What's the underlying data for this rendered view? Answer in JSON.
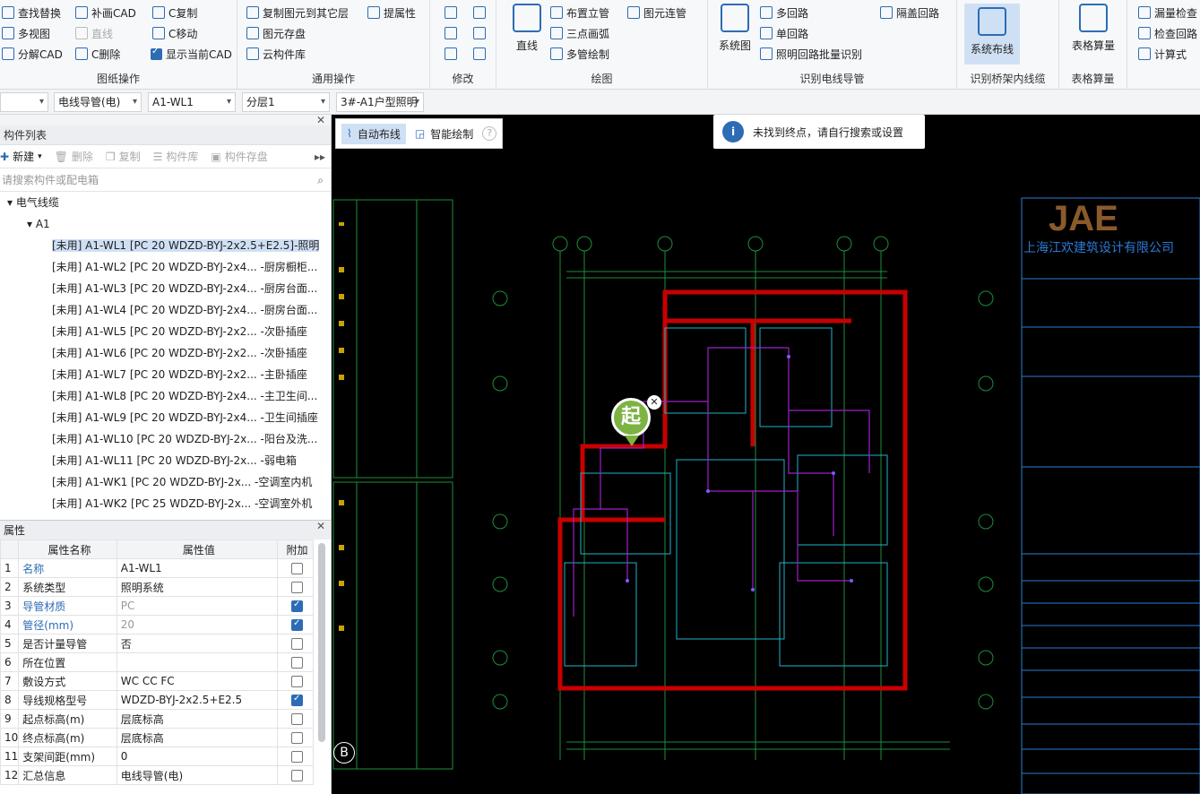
{
  "ribbon": {
    "g1": {
      "label": "图纸操作",
      "items": [
        "查找替换",
        "补画CAD",
        "C复制",
        "多视图",
        "直线",
        "C移动",
        "分解CAD",
        "C删除",
        "显示当前CAD"
      ]
    },
    "g2": {
      "label": "通用操作",
      "items": [
        "复制图元到其它层",
        "提属性",
        "图元存盘",
        "云构件库"
      ]
    },
    "g3": {
      "label": "修改"
    },
    "g4": {
      "label": "绘图",
      "items": [
        "直线",
        "布置立管",
        "图元连管",
        "三点画弧",
        "多管绘制"
      ]
    },
    "g5": {
      "label": "识别电线导管",
      "items": [
        "系统图",
        "多回路",
        "隔盖回路",
        "单回路",
        "照明回路批量识别"
      ]
    },
    "g6": {
      "label": "识别桥架内线缆",
      "items": [
        "系统布线"
      ]
    },
    "g7": {
      "label": "表格算量",
      "items": [
        "表格算量"
      ]
    },
    "g8": {
      "items": [
        "漏量检查",
        "检查回路",
        "计算式"
      ]
    }
  },
  "selectors": [
    "",
    "电线导管(电)",
    "A1-WL1",
    "分层1",
    "3#-A1户型照明"
  ],
  "components": {
    "title": "构件列表",
    "toolbar": [
      "新建",
      "删除",
      "复制",
      "构件库",
      "构件存盘"
    ],
    "search_placeholder": "请搜索构件或配电箱",
    "root": "电气线缆",
    "group": "A1",
    "items": [
      "[未用] A1-WL1 [PC 20 WDZD-BYJ-2x2.5+E2.5]-照明",
      "[未用] A1-WL2 [PC 20 WDZD-BYJ-2x4... -厨房橱柜...",
      "[未用] A1-WL3 [PC 20 WDZD-BYJ-2x4... -厨房台面...",
      "[未用] A1-WL4 [PC 20 WDZD-BYJ-2x4... -厨房台面...",
      "[未用] A1-WL5 [PC 20 WDZD-BYJ-2x2... -次卧插座",
      "[未用] A1-WL6 [PC 20 WDZD-BYJ-2x2... -次卧插座",
      "[未用] A1-WL7 [PC 20 WDZD-BYJ-2x2... -主卧插座",
      "[未用] A1-WL8 [PC 20 WDZD-BYJ-2x4... -主卫生间...",
      "[未用] A1-WL9 [PC 20 WDZD-BYJ-2x4... -卫生间插座",
      "[未用] A1-WL10 [PC 20 WDZD-BYJ-2x... -阳台及洗...",
      "[未用] A1-WL11 [PC 20 WDZD-BYJ-2x... -弱电箱",
      "[未用] A1-WK1 [PC 20 WDZD-BYJ-2x... -空调室内机",
      "[未用] A1-WK2 [PC 25 WDZD-BYJ-2x... -空调室外机"
    ]
  },
  "props": {
    "title": "属性",
    "headers": [
      "属性名称",
      "属性值",
      "附加"
    ],
    "rows": [
      {
        "n": "1",
        "name": "名称",
        "val": "A1-WL1"
      },
      {
        "n": "2",
        "name": "系统类型",
        "val": "照明系统"
      },
      {
        "n": "3",
        "name": "导管材质",
        "val": "PC"
      },
      {
        "n": "4",
        "name": "管径(mm)",
        "val": "20"
      },
      {
        "n": "5",
        "name": "是否计量导管",
        "val": "否"
      },
      {
        "n": "6",
        "name": "所在位置",
        "val": ""
      },
      {
        "n": "7",
        "name": "敷设方式",
        "val": "WC CC FC"
      },
      {
        "n": "8",
        "name": "导线规格型号",
        "val": "WDZD-BYJ-2x2.5+E2.5"
      },
      {
        "n": "9",
        "name": "起点标高(m)",
        "val": "层底标高"
      },
      {
        "n": "10",
        "name": "终点标高(m)",
        "val": "层底标高"
      },
      {
        "n": "11",
        "name": "支架间距(mm)",
        "val": "0"
      },
      {
        "n": "12",
        "name": "汇总信息",
        "val": "电线导管(电)"
      }
    ]
  },
  "canvas": {
    "modes": [
      "自动布线",
      "智能绘制"
    ],
    "toast": "未找到终点，请自行搜索或设置",
    "start_marker": "起",
    "label_b": "B",
    "title_block": {
      "logo": "JAE",
      "company": "上海江欢建筑设计有限公司"
    }
  }
}
